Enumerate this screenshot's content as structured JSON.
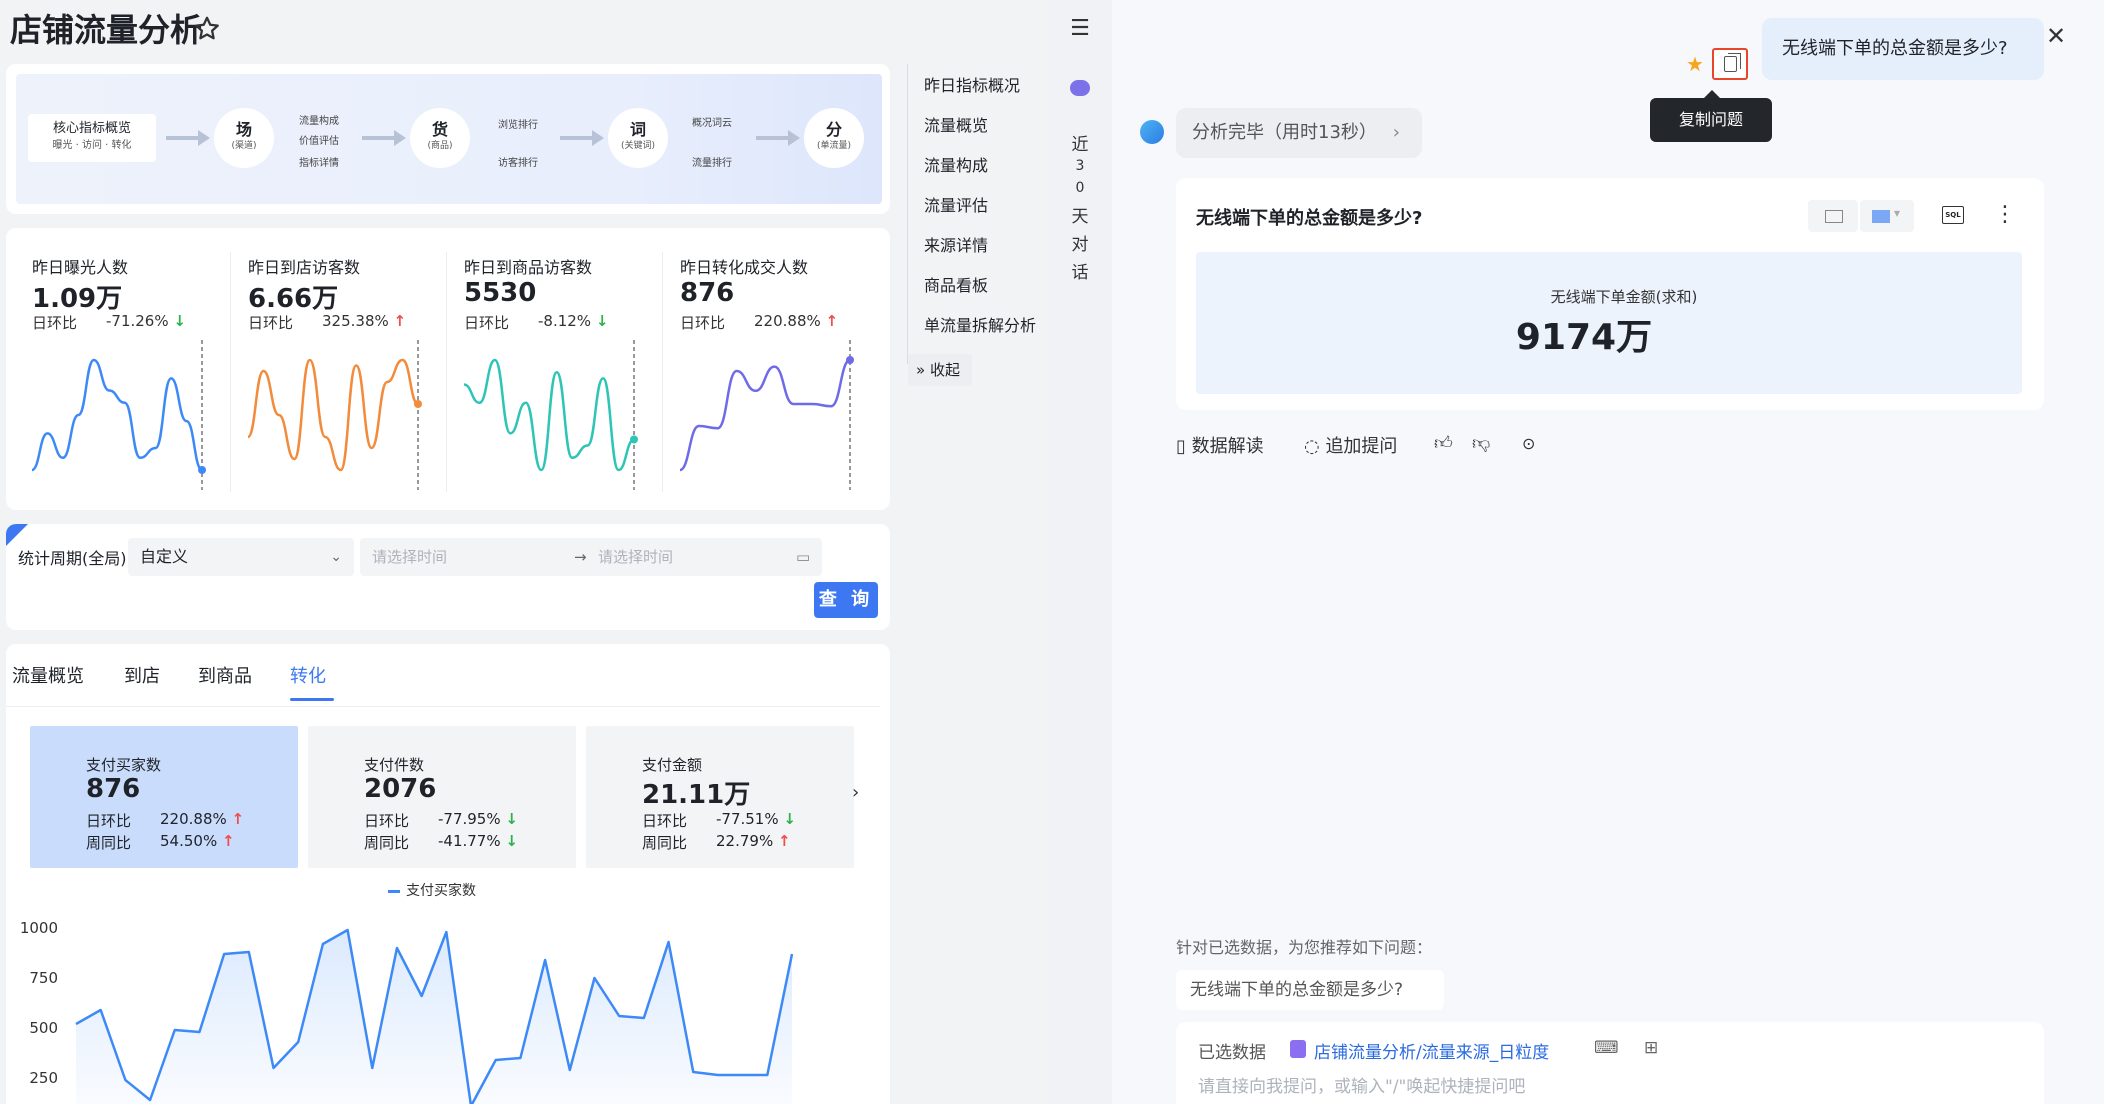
{
  "page": {
    "title": "店铺流量分析"
  },
  "flow": {
    "core": {
      "title": "核心指标概览",
      "sub": "曝光 · 访问 · 转化"
    },
    "steps": [
      {
        "title": "场",
        "sub": "(渠道)",
        "labels": [
          "流量构成",
          "价值评估",
          "指标详情"
        ]
      },
      {
        "title": "货",
        "sub": "(商品)",
        "labels": [
          "浏览排行",
          "访客排行"
        ]
      },
      {
        "title": "词",
        "sub": "(关键词)",
        "labels": [
          "概况词云",
          "流量排行"
        ]
      },
      {
        "title": "分",
        "sub": "(单流量)",
        "labels": []
      }
    ]
  },
  "metrics": [
    {
      "title": "昨日曝光人数",
      "value": "1.09万",
      "change_label": "日环比",
      "change": "-71.26%",
      "dir": "down",
      "color": "#3d8af7",
      "series": [
        30,
        60,
        40,
        75,
        120,
        95,
        85,
        40,
        48,
        105,
        70,
        30
      ]
    },
    {
      "title": "昨日到店访客数",
      "value": "6.66万",
      "change_label": "日环比",
      "change": "325.38%",
      "dir": "up",
      "color": "#f28b3c",
      "series": [
        40,
        100,
        60,
        20,
        110,
        40,
        10,
        105,
        30,
        90,
        110,
        70
      ]
    },
    {
      "title": "昨日到商品访客数",
      "value": "5530",
      "change_label": "日环比",
      "change": "-8.12%",
      "dir": "down",
      "color": "#2ec4b6",
      "series": [
        100,
        85,
        120,
        60,
        85,
        30,
        110,
        40,
        50,
        105,
        30,
        55
      ]
    },
    {
      "title": "昨日转化成交人数",
      "value": "876",
      "change_label": "日环比",
      "change": "220.88%",
      "dir": "up",
      "color": "#6f6ae8",
      "series": [
        20,
        60,
        58,
        110,
        92,
        114,
        80,
        80,
        78,
        120
      ]
    }
  ],
  "filter": {
    "label": "统计周期(全局)",
    "select_value": "自定义",
    "start_placeholder": "请选择时间",
    "end_placeholder": "请选择时间",
    "query_label": "查 询"
  },
  "tabs": [
    "流量概览",
    "到店",
    "到商品",
    "转化"
  ],
  "kpis": [
    {
      "title": "支付买家数",
      "value": "876",
      "r1_label": "日环比",
      "r1": "220.88%",
      "r1_dir": "up",
      "r2_label": "周同比",
      "r2": "54.50%",
      "r2_dir": "up"
    },
    {
      "title": "支付件数",
      "value": "2076",
      "r1_label": "日环比",
      "r1": "-77.95%",
      "r1_dir": "down",
      "r2_label": "周同比",
      "r2": "-41.77%",
      "r2_dir": "down"
    },
    {
      "title": "支付金额",
      "value": "21.11万",
      "r1_label": "日环比",
      "r1": "-77.51%",
      "r1_dir": "down",
      "r2_label": "周同比",
      "r2": "22.79%",
      "r2_dir": "up"
    }
  ],
  "chart_data": {
    "type": "line",
    "series": [
      {
        "name": "支付买家数",
        "values": [
          520,
          590,
          240,
          140,
          490,
          480,
          870,
          880,
          300,
          430,
          920,
          990,
          300,
          900,
          660,
          980,
          110,
          340,
          350,
          840,
          290,
          750,
          560,
          550,
          930,
          280,
          265,
          265,
          265,
          870
        ]
      }
    ],
    "yticks": [
      "1000",
      "750",
      "500",
      "250"
    ],
    "ylim": [
      150,
      1000
    ],
    "color": "#3d8af7"
  },
  "nav": {
    "items": [
      "昨日指标概况",
      "流量概览",
      "流量构成",
      "流量评估",
      "来源详情",
      "商品看板",
      "单流量拆解分析"
    ],
    "collapse": "收起"
  },
  "chat_sidebar": {
    "history_label": [
      "近",
      "3",
      "0",
      "天",
      "对",
      "话"
    ]
  },
  "chat": {
    "question": "无线端下单的总金额是多少?",
    "tooltip": "复制问题",
    "status": "分析完毕（用时13秒）",
    "answer_title": "无线端下单的总金额是多少?",
    "metric_label": "无线端下单金额(求和)",
    "metric_value": "9174万",
    "actions": [
      "数据解读",
      "追加提问"
    ],
    "recommend_label": "针对已选数据，为您推荐如下问题：",
    "recommend_q": "无线端下单的总金额是多少?",
    "selected_label": "已选数据",
    "selected_source": "店铺流量分析/流量来源_日粒度",
    "input_placeholder": "请直接向我提问，或输入\"/\"唤起快捷提问吧"
  }
}
